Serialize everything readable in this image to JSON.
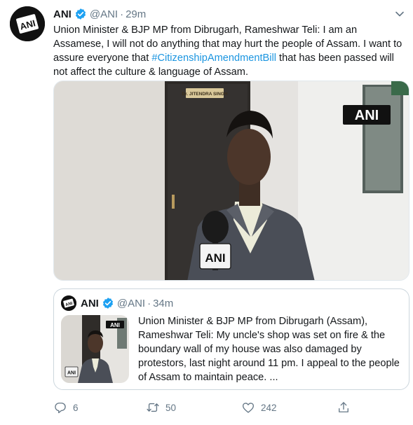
{
  "tweet": {
    "author_name": "ANI",
    "author_handle": "@ANI",
    "separator": "·",
    "time": "29m",
    "avatar_icon": "ani-logo-avatar",
    "verified_icon": "verified-badge-icon",
    "text_before": "Union Minister & BJP MP from Dibrugarh, Rameshwar Teli: I am an Assamese, I will not do anything that may hurt the people of Assam. I want to assure everyone that ",
    "hashtag": "#CitizenshipAmendmentBill",
    "text_after": " that has been passed will not affect the culture & language of Assam.",
    "media_watermark": "ANI",
    "door_nameplate": "Dr. JITENDRA SINGH",
    "mic_label": "ANI"
  },
  "quote": {
    "author_name": "ANI",
    "author_handle": "@ANI",
    "separator": "·",
    "time": "34m",
    "text": "Union Minister & BJP MP from Dibrugarh (Assam), Rameshwar Teli: My uncle's shop was set on fire & the boundary wall of my house was also damaged by protestors, last night around 11 pm. I appeal to the people of Assam to maintain peace. ...",
    "thumb_watermark": "ANI",
    "thumb_mic_label": "ANI"
  },
  "actions": {
    "reply_count": "6",
    "retweet_count": "50",
    "like_count": "242",
    "icons": [
      "reply-icon",
      "retweet-icon",
      "like-icon",
      "share-icon"
    ]
  },
  "colors": {
    "text": "#14171a",
    "secondary": "#657786",
    "link": "#1b95e0",
    "verified": "#1da1f2",
    "border": "#ccd6dd"
  }
}
